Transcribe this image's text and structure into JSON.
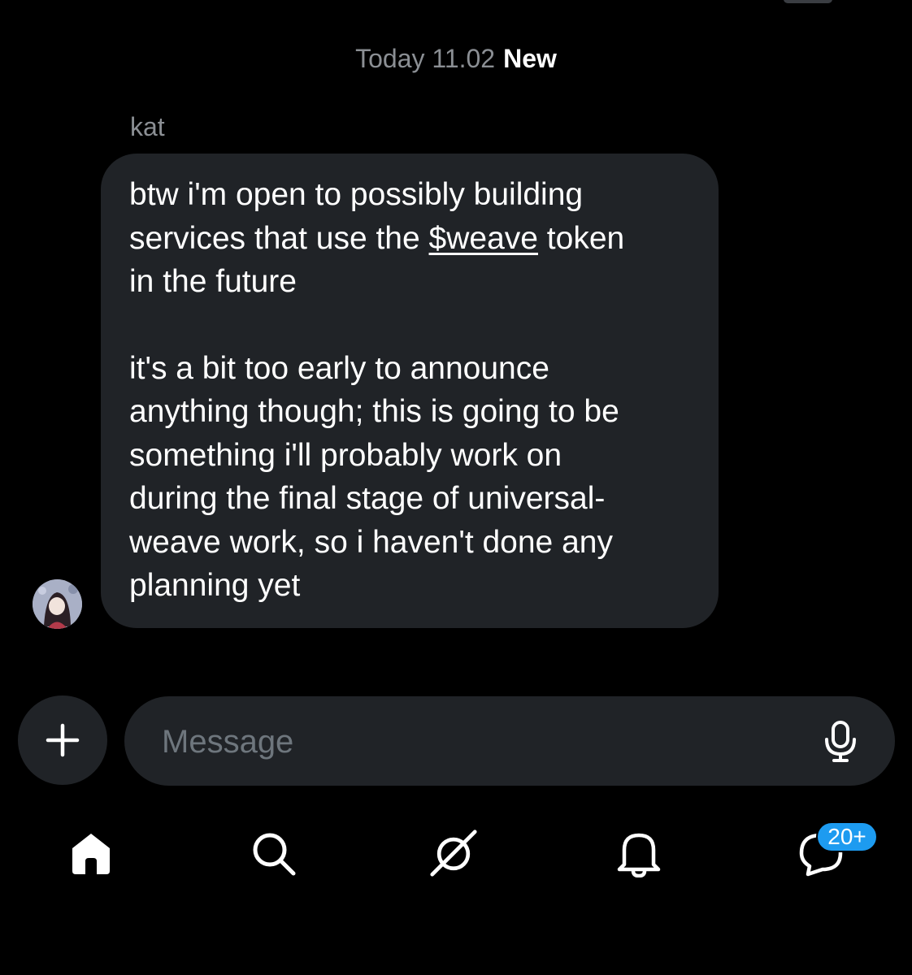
{
  "conversation": {
    "date_label": "Today 11.02",
    "new_label": "New",
    "sender_name": "kat",
    "message": {
      "paragraph1_before": "btw i'm open to possibly building\nservices that use the ",
      "mention": "$weave",
      "paragraph1_after": " token\nin the future",
      "paragraph2": "it's a bit too early to announce\nanything though; this is going to be\nsomething i'll probably work on\nduring the final stage of universal-\nweave work, so i haven't done any\nplanning yet"
    }
  },
  "composer": {
    "placeholder": "Message",
    "add_icon": "plus-icon",
    "mic_icon": "microphone-icon"
  },
  "bottom_nav": {
    "items": [
      {
        "name": "home",
        "icon": "home-icon"
      },
      {
        "name": "search",
        "icon": "search-icon"
      },
      {
        "name": "grok",
        "icon": "grok-icon"
      },
      {
        "name": "notifications",
        "icon": "bell-icon"
      },
      {
        "name": "messages",
        "icon": "messages-icon"
      }
    ],
    "messages_badge": "20+"
  },
  "colors": {
    "background": "#000000",
    "bubble": "#202327",
    "muted_text": "#8b8f94",
    "accent": "#1d9bf0"
  }
}
